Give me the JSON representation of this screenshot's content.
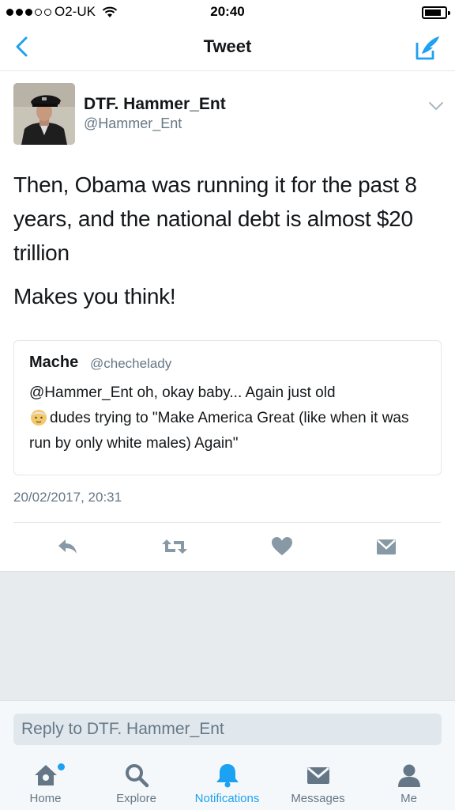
{
  "status_bar": {
    "carrier": "O2-UK",
    "time": "20:40"
  },
  "nav": {
    "title": "Tweet"
  },
  "tweet": {
    "author_name": "DTF. Hammer_Ent",
    "author_handle": "@Hammer_Ent",
    "text": "Then, Obama was running it for the past 8 years, and the national debt is almost $20 trillion",
    "text2": "Makes you think!",
    "timestamp": "20/02/2017, 20:31"
  },
  "quote": {
    "name": "Mache",
    "handle": "@chechelady",
    "text_before_emoji": "@Hammer_Ent oh,  okay baby... Again just old",
    "text_after_emoji": "dudes trying to \"Make America Great (like when it was run by only white males) Again\""
  },
  "reply": {
    "placeholder": "Reply to DTF. Hammer_Ent"
  },
  "tabs": [
    {
      "label": "Home",
      "icon": "home-icon"
    },
    {
      "label": "Explore",
      "icon": "search-icon"
    },
    {
      "label": "Notifications",
      "icon": "bell-icon"
    },
    {
      "label": "Messages",
      "icon": "envelope-icon"
    },
    {
      "label": "Me",
      "icon": "person-icon"
    }
  ],
  "colors": {
    "accent": "#1da1f2",
    "secondary_text": "#657786",
    "action_icon": "#8899a6"
  }
}
